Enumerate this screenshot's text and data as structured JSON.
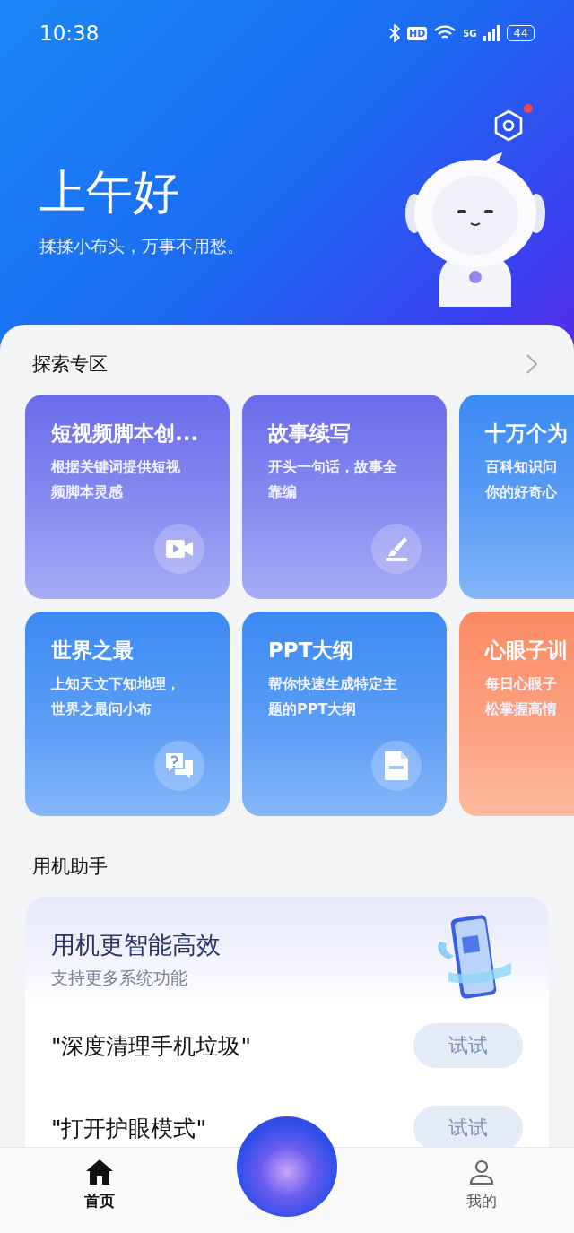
{
  "status_bar": {
    "time": "10:38",
    "hd": "HD",
    "network": "5G",
    "battery": "44"
  },
  "header": {
    "greeting": "上午好",
    "subtitle": "揉揉小布头，万事不用愁。",
    "settings_badge": true
  },
  "explore": {
    "title": "探索专区",
    "cards": [
      {
        "kind": "purple",
        "title": "短视频脚本创...",
        "desc_lines": [
          "根据关键词提供短视",
          "频脚本灵感"
        ]
      },
      {
        "kind": "purple",
        "title": "故事续写",
        "desc_lines": [
          "开头一句话，故事全",
          "靠编"
        ]
      },
      {
        "kind": "blue",
        "title": "十万个为",
        "desc_lines": [
          "百科知识问",
          "你的好奇心"
        ]
      },
      {
        "kind": "blue",
        "title": "世界之最",
        "desc_lines": [
          "上知天文下知地理，",
          "世界之最问小布"
        ]
      },
      {
        "kind": "blue",
        "title": "PPT大纲",
        "desc_lines": [
          "帮你快速生成特定主",
          "题的PPT大纲"
        ]
      },
      {
        "kind": "orange",
        "title": "心眼子训",
        "desc_lines": [
          "每日心眼子",
          "松掌握高情"
        ]
      }
    ]
  },
  "assistant": {
    "title": "用机助手",
    "banner_title": "用机更智能高效",
    "banner_subtitle": "支持更多系统功能",
    "rows": [
      {
        "command": "\"深度清理手机垃圾\"",
        "button": "试试"
      },
      {
        "command": "\"打开护眼模式\"",
        "button": "试试"
      }
    ]
  },
  "bottom_nav": [
    {
      "label": "首页",
      "selected": true
    },
    {
      "label": "我的",
      "selected": false
    }
  ]
}
